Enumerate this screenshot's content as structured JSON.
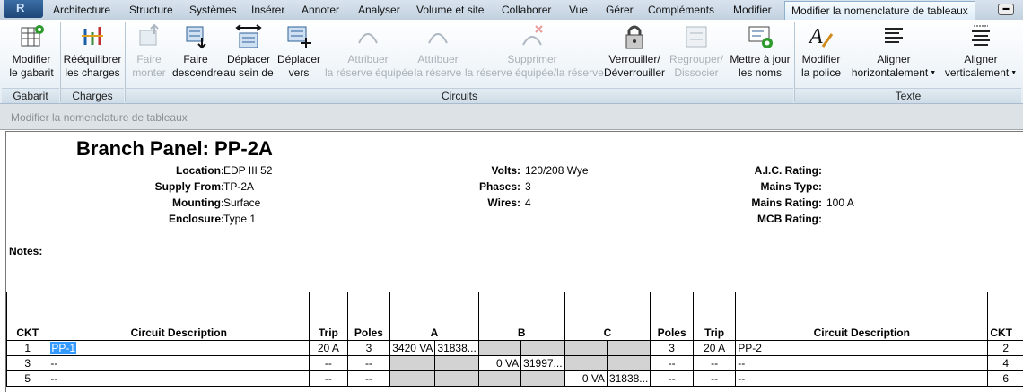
{
  "tabs": [
    {
      "label": "Architecture"
    },
    {
      "label": "Structure"
    },
    {
      "label": "Systèmes"
    },
    {
      "label": "Insérer"
    },
    {
      "label": "Annoter"
    },
    {
      "label": "Analyser"
    },
    {
      "label": "Volume et site"
    },
    {
      "label": "Collaborer"
    },
    {
      "label": "Vue"
    },
    {
      "label": "Gérer"
    },
    {
      "label": "Compléments"
    },
    {
      "label": "Modifier"
    },
    {
      "label": "Modifier la nomenclature de tableaux",
      "active": true
    }
  ],
  "ribbon": {
    "buttons": {
      "modify_template": {
        "l1": "Modifier",
        "l2": "le gabarit",
        "icon": "template-icon"
      },
      "rebalance": {
        "l1": "Rééquilibrer",
        "l2": "les charges",
        "icon": "rebalance-icon"
      },
      "move_up": {
        "l1": "Faire",
        "l2": "monter",
        "icon": "move-up-icon",
        "disabled": true
      },
      "move_down": {
        "l1": "Faire",
        "l2": "descendre",
        "icon": "move-down-icon"
      },
      "move_across": {
        "l1": "Déplacer",
        "l2": "au sein de",
        "icon": "move-across-icon"
      },
      "move_to": {
        "l1": "Déplacer",
        "l2": "vers",
        "icon": "move-to-icon"
      },
      "assign_spare": {
        "l1": "Attribuer",
        "l2": "la réserve équipée",
        "icon": "spare-icon",
        "disabled": true
      },
      "assign_space": {
        "l1": "Attribuer",
        "l2": "la réserve",
        "icon": "space-icon",
        "disabled": true
      },
      "remove_spare": {
        "l1": "Supprimer",
        "l2": "la réserve équipée/la réserve",
        "icon": "remove-spare-icon",
        "disabled": true
      },
      "lock": {
        "l1": "Verrouiller/",
        "l2": "Déverrouiller",
        "icon": "lock-icon"
      },
      "group": {
        "l1": "Regrouper/",
        "l2": "Dissocier",
        "icon": "group-icon",
        "disabled": true
      },
      "update_names": {
        "l1": "Mettre à jour",
        "l2": "les noms",
        "icon": "update-names-icon"
      },
      "font": {
        "l1": "Modifier",
        "l2": "la police",
        "icon": "font-icon"
      },
      "align_h": {
        "l1": "Aligner",
        "l2": "horizontalement",
        "icon": "align-horizontal-icon"
      },
      "align_v": {
        "l1": "Aligner",
        "l2": "verticalement",
        "icon": "align-vertical-icon"
      }
    },
    "groups": {
      "gabarit": "Gabarit",
      "charges": "Charges",
      "circuits": "Circuits",
      "texte": "Texte"
    }
  },
  "context_bar": "Modifier la nomenclature de tableaux",
  "panel": {
    "title": "Branch Panel: PP-2A",
    "fields": {
      "location": {
        "label": "Location:",
        "value": "EDP III 52"
      },
      "supply_from": {
        "label": "Supply From:",
        "value": "TP-2A"
      },
      "mounting": {
        "label": "Mounting:",
        "value": "Surface"
      },
      "enclosure": {
        "label": "Enclosure:",
        "value": "Type 1"
      },
      "volts": {
        "label": "Volts:",
        "value": "120/208 Wye"
      },
      "phases": {
        "label": "Phases:",
        "value": "3"
      },
      "wires": {
        "label": "Wires:",
        "value": "4"
      },
      "aic": {
        "label": "A.I.C. Rating:",
        "value": ""
      },
      "mains_type": {
        "label": "Mains Type:",
        "value": ""
      },
      "mains_rating": {
        "label": "Mains Rating:",
        "value": "100 A"
      },
      "mcb": {
        "label": "MCB Rating:",
        "value": ""
      }
    },
    "notes_label": "Notes:",
    "headers": [
      "CKT",
      "Circuit Description",
      "Trip",
      "Poles",
      "A",
      "B",
      "C",
      "Poles",
      "Trip",
      "Circuit Description",
      "CKT"
    ],
    "rows": [
      {
        "ckt_l": "1",
        "desc_l": "PP-1",
        "trip_l": "20 A",
        "poles_l": "3",
        "a1": "3420 VA",
        "a2": "31838...",
        "b1": "",
        "b2": "",
        "c1": "",
        "c2": "",
        "poles_r": "3",
        "trip_r": "20 A",
        "desc_r": "PP-2",
        "ckt_r": "2"
      },
      {
        "ckt_l": "3",
        "desc_l": "--",
        "trip_l": "--",
        "poles_l": "--",
        "a1": "",
        "a2": "",
        "b1": "0 VA",
        "b2": "31997...",
        "c1": "",
        "c2": "",
        "poles_r": "--",
        "trip_r": "--",
        "desc_r": "--",
        "ckt_r": "4"
      },
      {
        "ckt_l": "5",
        "desc_l": "--",
        "trip_l": "--",
        "poles_l": "--",
        "a1": "",
        "a2": "",
        "b1": "",
        "b2": "",
        "c1": "0 VA",
        "c2": "31838...",
        "poles_r": "--",
        "trip_r": "--",
        "desc_r": "--",
        "ckt_r": "6"
      }
    ]
  }
}
